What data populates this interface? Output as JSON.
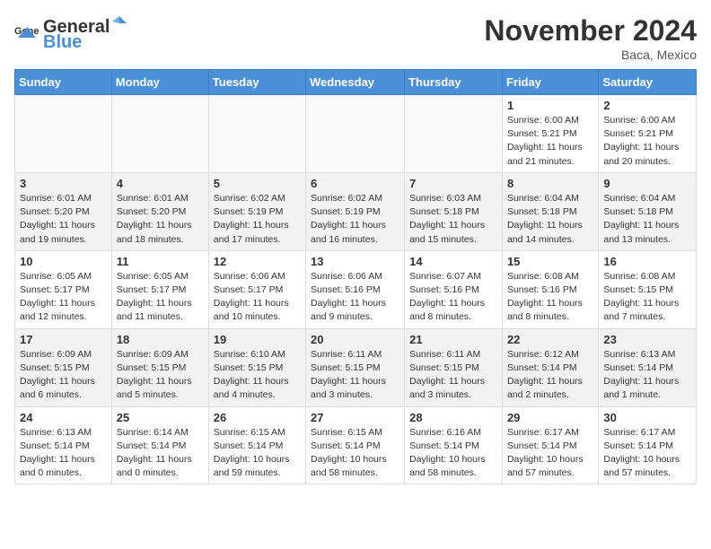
{
  "header": {
    "logo_general": "General",
    "logo_blue": "Blue",
    "month": "November 2024",
    "location": "Baca, Mexico"
  },
  "weekdays": [
    "Sunday",
    "Monday",
    "Tuesday",
    "Wednesday",
    "Thursday",
    "Friday",
    "Saturday"
  ],
  "weeks": [
    [
      {
        "day": "",
        "info": ""
      },
      {
        "day": "",
        "info": ""
      },
      {
        "day": "",
        "info": ""
      },
      {
        "day": "",
        "info": ""
      },
      {
        "day": "",
        "info": ""
      },
      {
        "day": "1",
        "info": "Sunrise: 6:00 AM\nSunset: 5:21 PM\nDaylight: 11 hours\nand 21 minutes."
      },
      {
        "day": "2",
        "info": "Sunrise: 6:00 AM\nSunset: 5:21 PM\nDaylight: 11 hours\nand 20 minutes."
      }
    ],
    [
      {
        "day": "3",
        "info": "Sunrise: 6:01 AM\nSunset: 5:20 PM\nDaylight: 11 hours\nand 19 minutes."
      },
      {
        "day": "4",
        "info": "Sunrise: 6:01 AM\nSunset: 5:20 PM\nDaylight: 11 hours\nand 18 minutes."
      },
      {
        "day": "5",
        "info": "Sunrise: 6:02 AM\nSunset: 5:19 PM\nDaylight: 11 hours\nand 17 minutes."
      },
      {
        "day": "6",
        "info": "Sunrise: 6:02 AM\nSunset: 5:19 PM\nDaylight: 11 hours\nand 16 minutes."
      },
      {
        "day": "7",
        "info": "Sunrise: 6:03 AM\nSunset: 5:18 PM\nDaylight: 11 hours\nand 15 minutes."
      },
      {
        "day": "8",
        "info": "Sunrise: 6:04 AM\nSunset: 5:18 PM\nDaylight: 11 hours\nand 14 minutes."
      },
      {
        "day": "9",
        "info": "Sunrise: 6:04 AM\nSunset: 5:18 PM\nDaylight: 11 hours\nand 13 minutes."
      }
    ],
    [
      {
        "day": "10",
        "info": "Sunrise: 6:05 AM\nSunset: 5:17 PM\nDaylight: 11 hours\nand 12 minutes."
      },
      {
        "day": "11",
        "info": "Sunrise: 6:05 AM\nSunset: 5:17 PM\nDaylight: 11 hours\nand 11 minutes."
      },
      {
        "day": "12",
        "info": "Sunrise: 6:06 AM\nSunset: 5:17 PM\nDaylight: 11 hours\nand 10 minutes."
      },
      {
        "day": "13",
        "info": "Sunrise: 6:06 AM\nSunset: 5:16 PM\nDaylight: 11 hours\nand 9 minutes."
      },
      {
        "day": "14",
        "info": "Sunrise: 6:07 AM\nSunset: 5:16 PM\nDaylight: 11 hours\nand 8 minutes."
      },
      {
        "day": "15",
        "info": "Sunrise: 6:08 AM\nSunset: 5:16 PM\nDaylight: 11 hours\nand 8 minutes."
      },
      {
        "day": "16",
        "info": "Sunrise: 6:08 AM\nSunset: 5:15 PM\nDaylight: 11 hours\nand 7 minutes."
      }
    ],
    [
      {
        "day": "17",
        "info": "Sunrise: 6:09 AM\nSunset: 5:15 PM\nDaylight: 11 hours\nand 6 minutes."
      },
      {
        "day": "18",
        "info": "Sunrise: 6:09 AM\nSunset: 5:15 PM\nDaylight: 11 hours\nand 5 minutes."
      },
      {
        "day": "19",
        "info": "Sunrise: 6:10 AM\nSunset: 5:15 PM\nDaylight: 11 hours\nand 4 minutes."
      },
      {
        "day": "20",
        "info": "Sunrise: 6:11 AM\nSunset: 5:15 PM\nDaylight: 11 hours\nand 3 minutes."
      },
      {
        "day": "21",
        "info": "Sunrise: 6:11 AM\nSunset: 5:15 PM\nDaylight: 11 hours\nand 3 minutes."
      },
      {
        "day": "22",
        "info": "Sunrise: 6:12 AM\nSunset: 5:14 PM\nDaylight: 11 hours\nand 2 minutes."
      },
      {
        "day": "23",
        "info": "Sunrise: 6:13 AM\nSunset: 5:14 PM\nDaylight: 11 hours\nand 1 minute."
      }
    ],
    [
      {
        "day": "24",
        "info": "Sunrise: 6:13 AM\nSunset: 5:14 PM\nDaylight: 11 hours\nand 0 minutes."
      },
      {
        "day": "25",
        "info": "Sunrise: 6:14 AM\nSunset: 5:14 PM\nDaylight: 11 hours\nand 0 minutes."
      },
      {
        "day": "26",
        "info": "Sunrise: 6:15 AM\nSunset: 5:14 PM\nDaylight: 10 hours\nand 59 minutes."
      },
      {
        "day": "27",
        "info": "Sunrise: 6:15 AM\nSunset: 5:14 PM\nDaylight: 10 hours\nand 58 minutes."
      },
      {
        "day": "28",
        "info": "Sunrise: 6:16 AM\nSunset: 5:14 PM\nDaylight: 10 hours\nand 58 minutes."
      },
      {
        "day": "29",
        "info": "Sunrise: 6:17 AM\nSunset: 5:14 PM\nDaylight: 10 hours\nand 57 minutes."
      },
      {
        "day": "30",
        "info": "Sunrise: 6:17 AM\nSunset: 5:14 PM\nDaylight: 10 hours\nand 57 minutes."
      }
    ]
  ]
}
